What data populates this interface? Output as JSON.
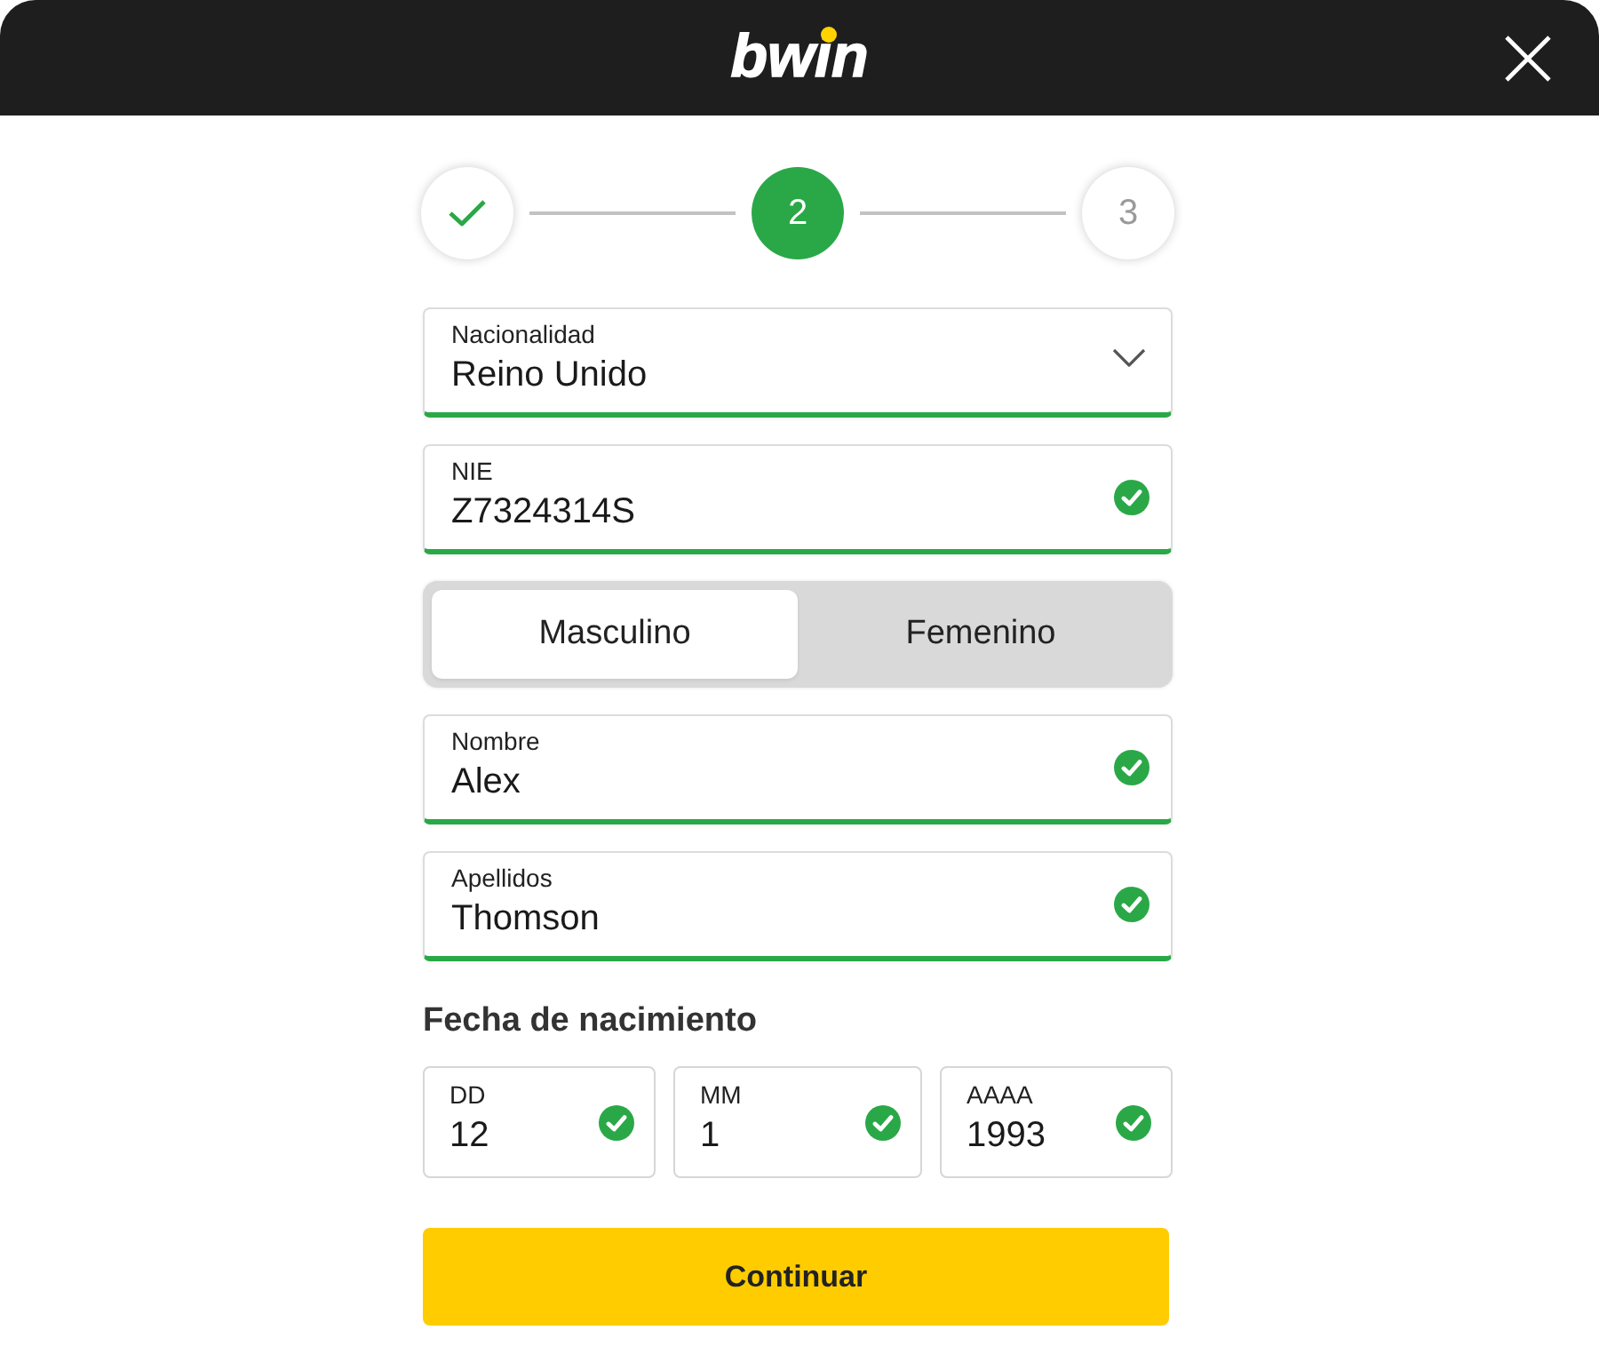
{
  "header": {
    "logo": "bwin"
  },
  "stepper": {
    "steps": [
      {
        "completed": true,
        "selected": false
      },
      {
        "label": "2",
        "completed": false,
        "selected": true
      },
      {
        "label": "3",
        "completed": false,
        "selected": false
      }
    ]
  },
  "form": {
    "items": [
      {
        "kind": "select",
        "label": "Nacionalidad",
        "value": "Reino Unido",
        "valid": true
      },
      {
        "kind": "text",
        "label": "NIE",
        "value": "Z7324314S",
        "valid": true
      },
      {
        "kind": "toggle",
        "options": [
          {
            "label": "Masculino",
            "selected": true
          },
          {
            "label": "Femenino",
            "selected": false
          }
        ]
      },
      {
        "kind": "text",
        "label": "Nombre",
        "value": "Alex",
        "valid": true
      },
      {
        "kind": "text",
        "label": "Apellidos",
        "value": "Thomson",
        "valid": true
      }
    ]
  },
  "birth_date": {
    "title": "Fecha de nacimiento",
    "fields": [
      {
        "label": "DD",
        "value": "12",
        "valid": true
      },
      {
        "label": "MM",
        "value": "1",
        "valid": true
      },
      {
        "label": "AAAA",
        "value": "1993",
        "valid": true
      }
    ]
  },
  "continue_button": {
    "label": "Continuar"
  }
}
